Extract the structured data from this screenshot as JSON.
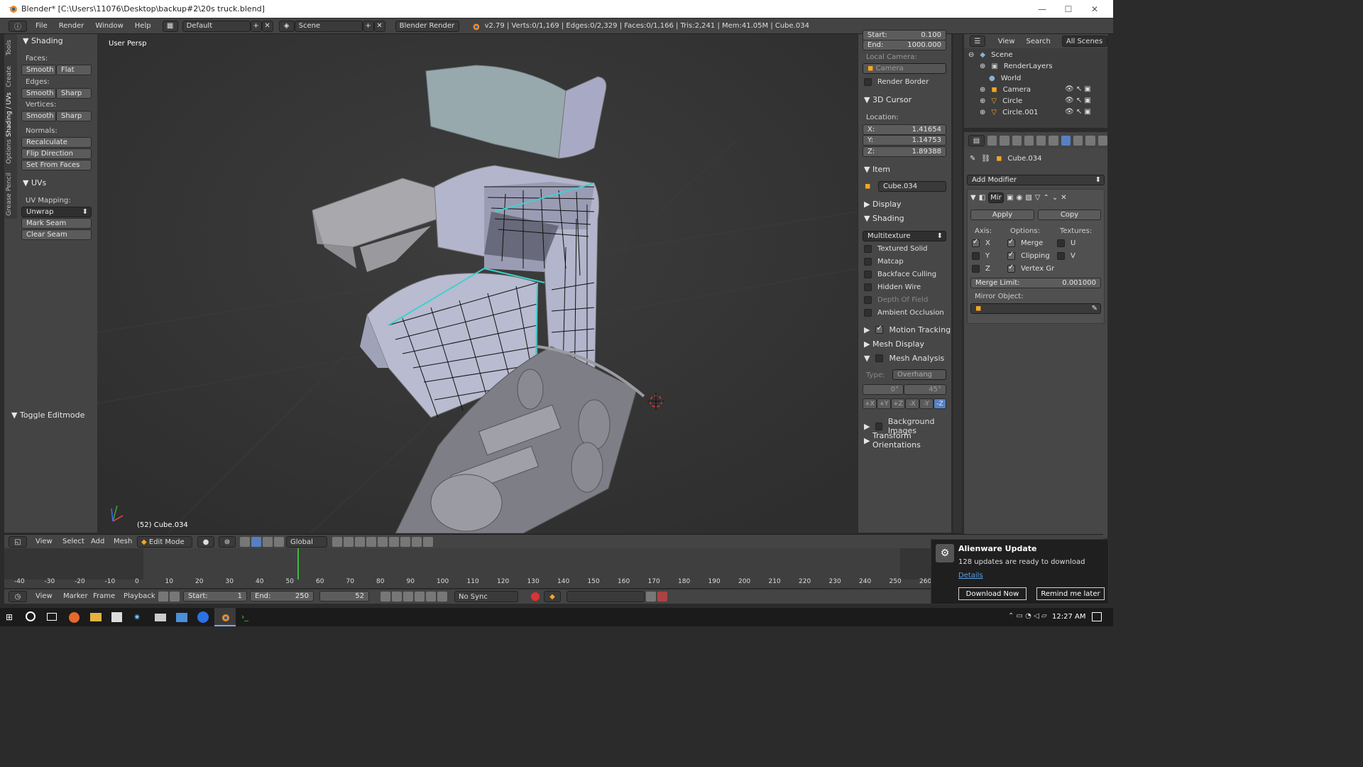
{
  "window": {
    "title": "Blender* [C:\\Users\\11076\\Desktop\\backup#2\\20s truck.blend]",
    "min": "—",
    "max": "☐",
    "close": "✕"
  },
  "topbar": {
    "menus": [
      "File",
      "Render",
      "Window",
      "Help"
    ],
    "layout": "Default",
    "scene": "Scene",
    "engine": "Blender Render",
    "stats": "v2.79 | Verts:0/1,169 | Edges:0/2,329 | Faces:0/1,166 | Tris:2,241 | Mem:41.05M | Cube.034"
  },
  "lefttabs": [
    "Tools",
    "Create",
    "Shading / UVs",
    "Options",
    "Grease Pencil"
  ],
  "toolshelf": {
    "shading_title": "Shading",
    "faces_label": "Faces:",
    "faces_smooth": "Smooth",
    "faces_flat": "Flat",
    "edges_label": "Edges:",
    "edges_smooth": "Smooth",
    "edges_sharp": "Sharp",
    "vertices_label": "Vertices:",
    "vertices_smooth": "Smooth",
    "vertices_sharp": "Sharp",
    "normals_label": "Normals:",
    "recalculate": "Recalculate",
    "flip": "Flip Direction",
    "set_from_faces": "Set From Faces",
    "uvs_title": "UVs",
    "uv_mapping_label": "UV Mapping:",
    "unwrap": "Unwrap",
    "mark_seam": "Mark Seam",
    "clear_seam": "Clear Seam",
    "toggle_editmode": "Toggle Editmode"
  },
  "viewport": {
    "label": "User Persp",
    "object_info": "(52) Cube.034"
  },
  "npanel": {
    "start_label": "Start:",
    "start_value": "0.100",
    "end_label": "End:",
    "end_value": "1000.000",
    "local_camera": "Local Camera:",
    "camera": "Camera",
    "render_border": "Render Border",
    "cursor_title": "3D Cursor",
    "location": "Location:",
    "x_label": "X:",
    "x_value": "1.41654",
    "y_label": "Y:",
    "y_value": "1.14753",
    "z_label": "Z:",
    "z_value": "1.89388",
    "item_title": "Item",
    "item_name": "Cube.034",
    "display_title": "Display",
    "shading_title": "Shading",
    "shading_mode": "Multitexture",
    "textured_solid": "Textured Solid",
    "matcap": "Matcap",
    "backface": "Backface Culling",
    "hidden_wire": "Hidden Wire",
    "dof": "Depth Of Field",
    "ao": "Ambient Occlusion",
    "motion_tracking": "Motion Tracking",
    "mesh_display": "Mesh Display",
    "mesh_analysis": "Mesh Analysis",
    "type_label": "Type:",
    "type_value": "Overhang",
    "angle_min": "0°",
    "angle_max": "45°",
    "axes": [
      "+X",
      "+Y",
      "+Z",
      "-X",
      "-Y",
      "-Z"
    ],
    "background_images": "Background Images",
    "transform_orientations": "Transform Orientations"
  },
  "outliner": {
    "view": "View",
    "search": "Search",
    "all_scenes": "All Scenes",
    "items": [
      "Scene",
      "RenderLayers",
      "World",
      "Camera",
      "Circle",
      "Circle.001"
    ]
  },
  "properties": {
    "object": "Cube.034",
    "add_modifier": "Add Modifier",
    "mod_name": "Mir",
    "apply": "Apply",
    "copy": "Copy",
    "axis_label": "Axis:",
    "options_label": "Options:",
    "textures_label": "Textures:",
    "x": "X",
    "y": "Y",
    "z": "Z",
    "merge": "Merge",
    "clipping": "Clipping",
    "vertex_gr": "Vertex Gr",
    "u": "U",
    "v": "V",
    "merge_limit_label": "Merge Limit:",
    "merge_limit_value": "0.001000",
    "mirror_object": "Mirror Object:"
  },
  "viewheader": {
    "view": "View",
    "select": "Select",
    "add": "Add",
    "mesh": "Mesh",
    "mode": "Edit Mode",
    "orientation": "Global"
  },
  "timeline": {
    "ticks": [
      "-40",
      "-30",
      "-20",
      "-10",
      "0",
      "10",
      "20",
      "30",
      "40",
      "50",
      "60",
      "70",
      "80",
      "90",
      "100",
      "110",
      "120",
      "130",
      "140",
      "150",
      "160",
      "170",
      "180",
      "190",
      "200",
      "210",
      "220",
      "230",
      "240",
      "250",
      "260"
    ],
    "current_frame_value": 52
  },
  "timelinebar": {
    "view": "View",
    "marker": "Marker",
    "frame": "Frame",
    "playback": "Playback",
    "start_label": "Start:",
    "start": "1",
    "end_label": "End:",
    "end": "250",
    "frame_value": "52",
    "sync": "No Sync"
  },
  "notification": {
    "title": "Alienware Update",
    "body": "128 updates are ready to download",
    "details": "Details",
    "download": "Download Now",
    "remind": "Remind me later"
  },
  "taskbar": {
    "time": "12:27 AM"
  },
  "colors": {
    "accent": "#5680c2",
    "seam": "#3fd0d0",
    "orange": "#f5a623"
  }
}
